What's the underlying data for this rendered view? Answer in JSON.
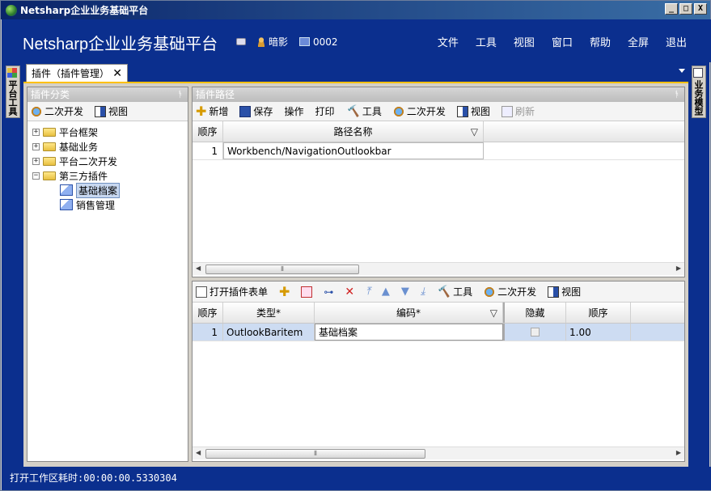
{
  "window": {
    "title": "Netsharp企业业务基础平台",
    "buttons": [
      "_",
      "□",
      "X"
    ]
  },
  "header": {
    "app_title": "Netsharp企业业务基础平台",
    "user": "暗影",
    "station": "0002",
    "menu": [
      "文件",
      "工具",
      "视图",
      "窗口",
      "帮助",
      "全屏",
      "退出"
    ]
  },
  "left_side_tab": "平台工具",
  "right_side_tab": "业务模型",
  "document_tab": {
    "label": "插件（插件管理）",
    "close": "✕"
  },
  "category_panel": {
    "title": "插件分类",
    "toolbar": {
      "dev": "二次开发",
      "view": "视图"
    },
    "tree": [
      {
        "label": "平台框架",
        "expander": "+"
      },
      {
        "label": "基础业务",
        "expander": "+"
      },
      {
        "label": "平台二次开发",
        "expander": "+"
      },
      {
        "label": "第三方插件",
        "expander": "−"
      },
      {
        "label": "基础档案"
      },
      {
        "label": "销售管理"
      }
    ]
  },
  "path_panel": {
    "title": "插件路径",
    "toolbar": {
      "add": "新增",
      "save": "保存",
      "operate": "操作",
      "print": "打印",
      "tools": "工具",
      "dev": "二次开发",
      "view": "视图",
      "refresh": "刷新"
    },
    "columns": [
      "顺序",
      "路径名称"
    ],
    "rows": [
      {
        "seq": "1",
        "path": "Workbench/NavigationOutlookbar"
      }
    ]
  },
  "form_panel": {
    "toolbar": {
      "open": "打开插件表单",
      "tools": "工具",
      "dev": "二次开发",
      "view": "视图"
    },
    "columns": [
      "顺序",
      "类型*",
      "编码*",
      "隐藏",
      "顺序"
    ],
    "rows": [
      {
        "seq": "1",
        "type": "OutlookBaritem",
        "code": "基础档案",
        "order": "1.00"
      }
    ]
  },
  "status": "打开工作区耗时:00:00:00.5330304"
}
